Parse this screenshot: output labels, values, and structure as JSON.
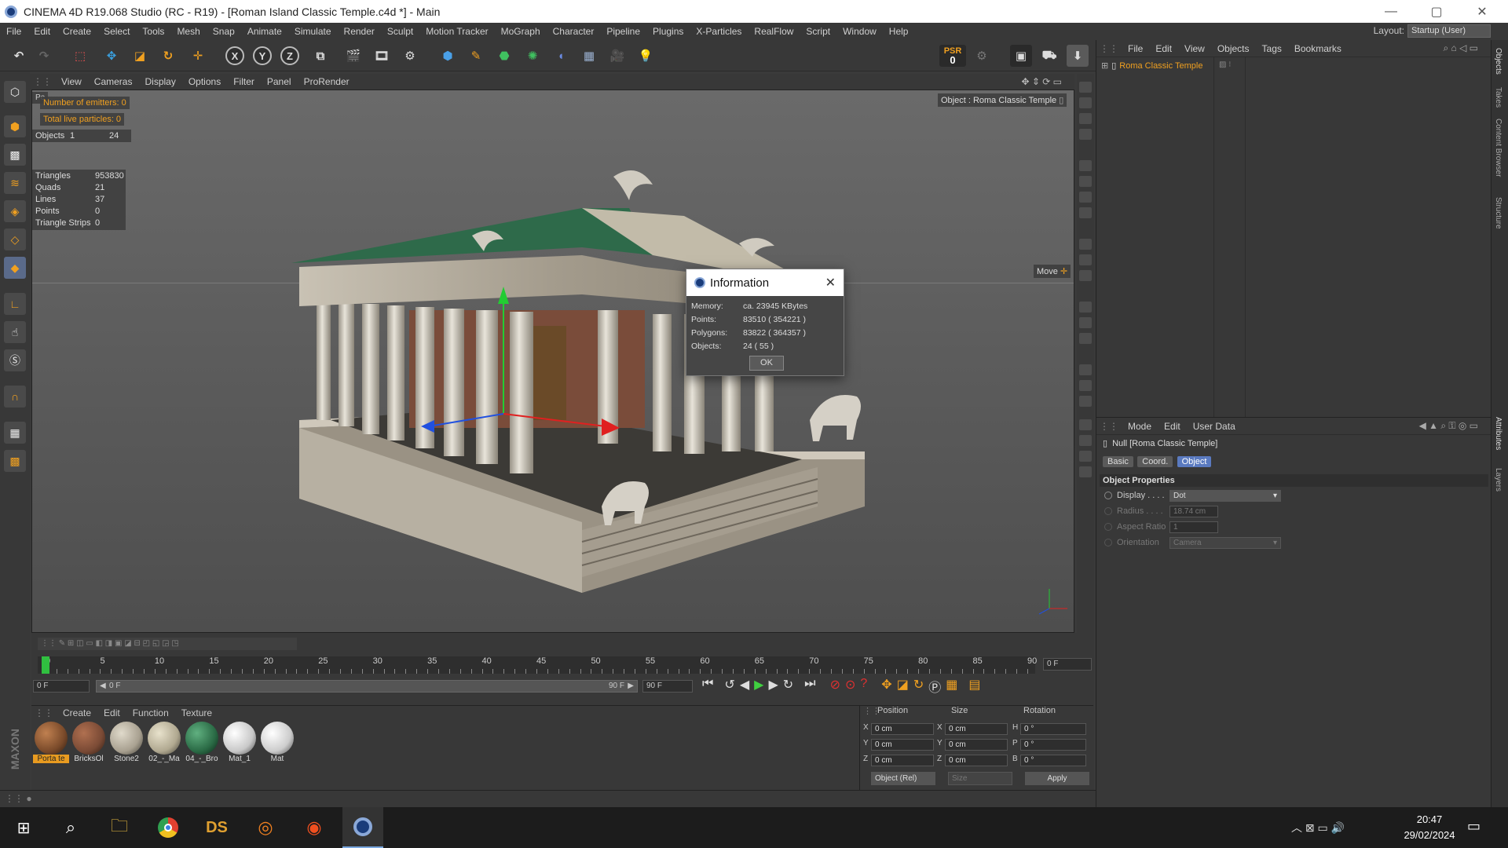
{
  "window": {
    "title": "CINEMA 4D R19.068 Studio (RC - R19) - [Roman Island Classic Temple.c4d *] - Main",
    "minimize": "—",
    "maximize": "▢",
    "close": "✕"
  },
  "menu": {
    "items": [
      "File",
      "Edit",
      "Create",
      "Select",
      "Tools",
      "Mesh",
      "Snap",
      "Animate",
      "Simulate",
      "Render",
      "Sculpt",
      "Motion Tracker",
      "MoGraph",
      "Character",
      "Pipeline",
      "Plugins",
      "X-Particles",
      "RealFlow",
      "Script",
      "Window",
      "Help"
    ],
    "layout_label": "Layout:",
    "layout_value": "Startup (User)"
  },
  "toolbar": {
    "axis_x": "X",
    "axis_y": "Y",
    "axis_z": "Z",
    "psr_label": "PSR",
    "psr_value": "0"
  },
  "viewport": {
    "menu": [
      "View",
      "Cameras",
      "Display",
      "Options",
      "Filter",
      "Panel",
      "ProRender"
    ],
    "corner_label": "Pe",
    "emitters": "Number of emitters: 0",
    "particles": "Total live particles: 0",
    "objects_label": "Objects",
    "objects_a": "1",
    "objects_b": "24",
    "stats": [
      {
        "k": "Triangles",
        "v": "953830"
      },
      {
        "k": "Quads",
        "v": "21"
      },
      {
        "k": "Lines",
        "v": "37"
      },
      {
        "k": "Points",
        "v": "0"
      },
      {
        "k": "Triangle Strips",
        "v": "0"
      }
    ],
    "object_tag": "Object : Roma Classic Temple",
    "move_tag": "Move"
  },
  "dialog": {
    "title": "Information",
    "rows": [
      {
        "k": "Memory:",
        "v": "ca. 23945 KBytes"
      },
      {
        "k": "Points:",
        "v": "83510 ( 354221 )"
      },
      {
        "k": "Polygons:",
        "v": "83822 ( 364357 )"
      },
      {
        "k": "Objects:",
        "v": "24 ( 55 )"
      }
    ],
    "ok": "OK"
  },
  "object_manager": {
    "menu": [
      "File",
      "Edit",
      "View",
      "Objects",
      "Tags",
      "Bookmarks"
    ],
    "object_name": "Roma Classic Temple"
  },
  "attributes": {
    "menu": [
      "Mode",
      "Edit",
      "User Data"
    ],
    "object_title": "Null [Roma Classic Temple]",
    "tabs": [
      "Basic",
      "Coord.",
      "Object"
    ],
    "active_tab": "Object",
    "section": "Object Properties",
    "display_label": "Display . . . .",
    "display_value": "Dot",
    "radius_label": "Radius . . . .",
    "radius_value": "18.74 cm",
    "aspect_label": "Aspect Ratio",
    "aspect_value": "1",
    "orientation_label": "Orientation",
    "orientation_value": "Camera"
  },
  "side_tabs": [
    "Objects",
    "Takes",
    "Content Browser",
    "Structure",
    "Attributes",
    "Layers"
  ],
  "timeline": {
    "ticks": [
      "0",
      "5",
      "10",
      "15",
      "20",
      "25",
      "30",
      "35",
      "40",
      "45",
      "50",
      "55",
      "60",
      "65",
      "70",
      "75",
      "80",
      "85",
      "90"
    ],
    "current_frame": "0 F",
    "start_frame": "0 F",
    "range_start": "0 F",
    "range_end": "90 F",
    "end_frame": "90 F"
  },
  "materials": {
    "menu": [
      "Create",
      "Edit",
      "Function",
      "Texture"
    ],
    "items": [
      {
        "name": "Porta te",
        "color": "#7a4a2a"
      },
      {
        "name": "BricksOl",
        "color": "#7a4a35"
      },
      {
        "name": "Stone2",
        "color": "#a8a090"
      },
      {
        "name": "02_-_Ma",
        "color": "#b0a890"
      },
      {
        "name": "04_-_Bro",
        "color": "#2a6a45"
      },
      {
        "name": "Mat_1",
        "color": "#c8c8c8"
      },
      {
        "name": "Mat",
        "color": "#cccccc"
      }
    ]
  },
  "coordinates": {
    "headers": [
      "Position",
      "Size",
      "Rotation"
    ],
    "rows": [
      {
        "a": "X",
        "pos": "0 cm",
        "b": "X",
        "size": "0 cm",
        "c": "H",
        "rot": "0 °"
      },
      {
        "a": "Y",
        "pos": "0 cm",
        "b": "Y",
        "size": "0 cm",
        "c": "P",
        "rot": "0 °"
      },
      {
        "a": "Z",
        "pos": "0 cm",
        "b": "Z",
        "size": "0 cm",
        "c": "B",
        "rot": "0 °"
      }
    ],
    "mode": "Object (Rel)",
    "size_mode": "Size",
    "apply": "Apply"
  },
  "brand": {
    "maxon": "MAXON",
    "c4d": "CINEMA 4D"
  },
  "taskbar": {
    "time": "20:47",
    "date": "29/02/2024",
    "ds": "DS"
  }
}
